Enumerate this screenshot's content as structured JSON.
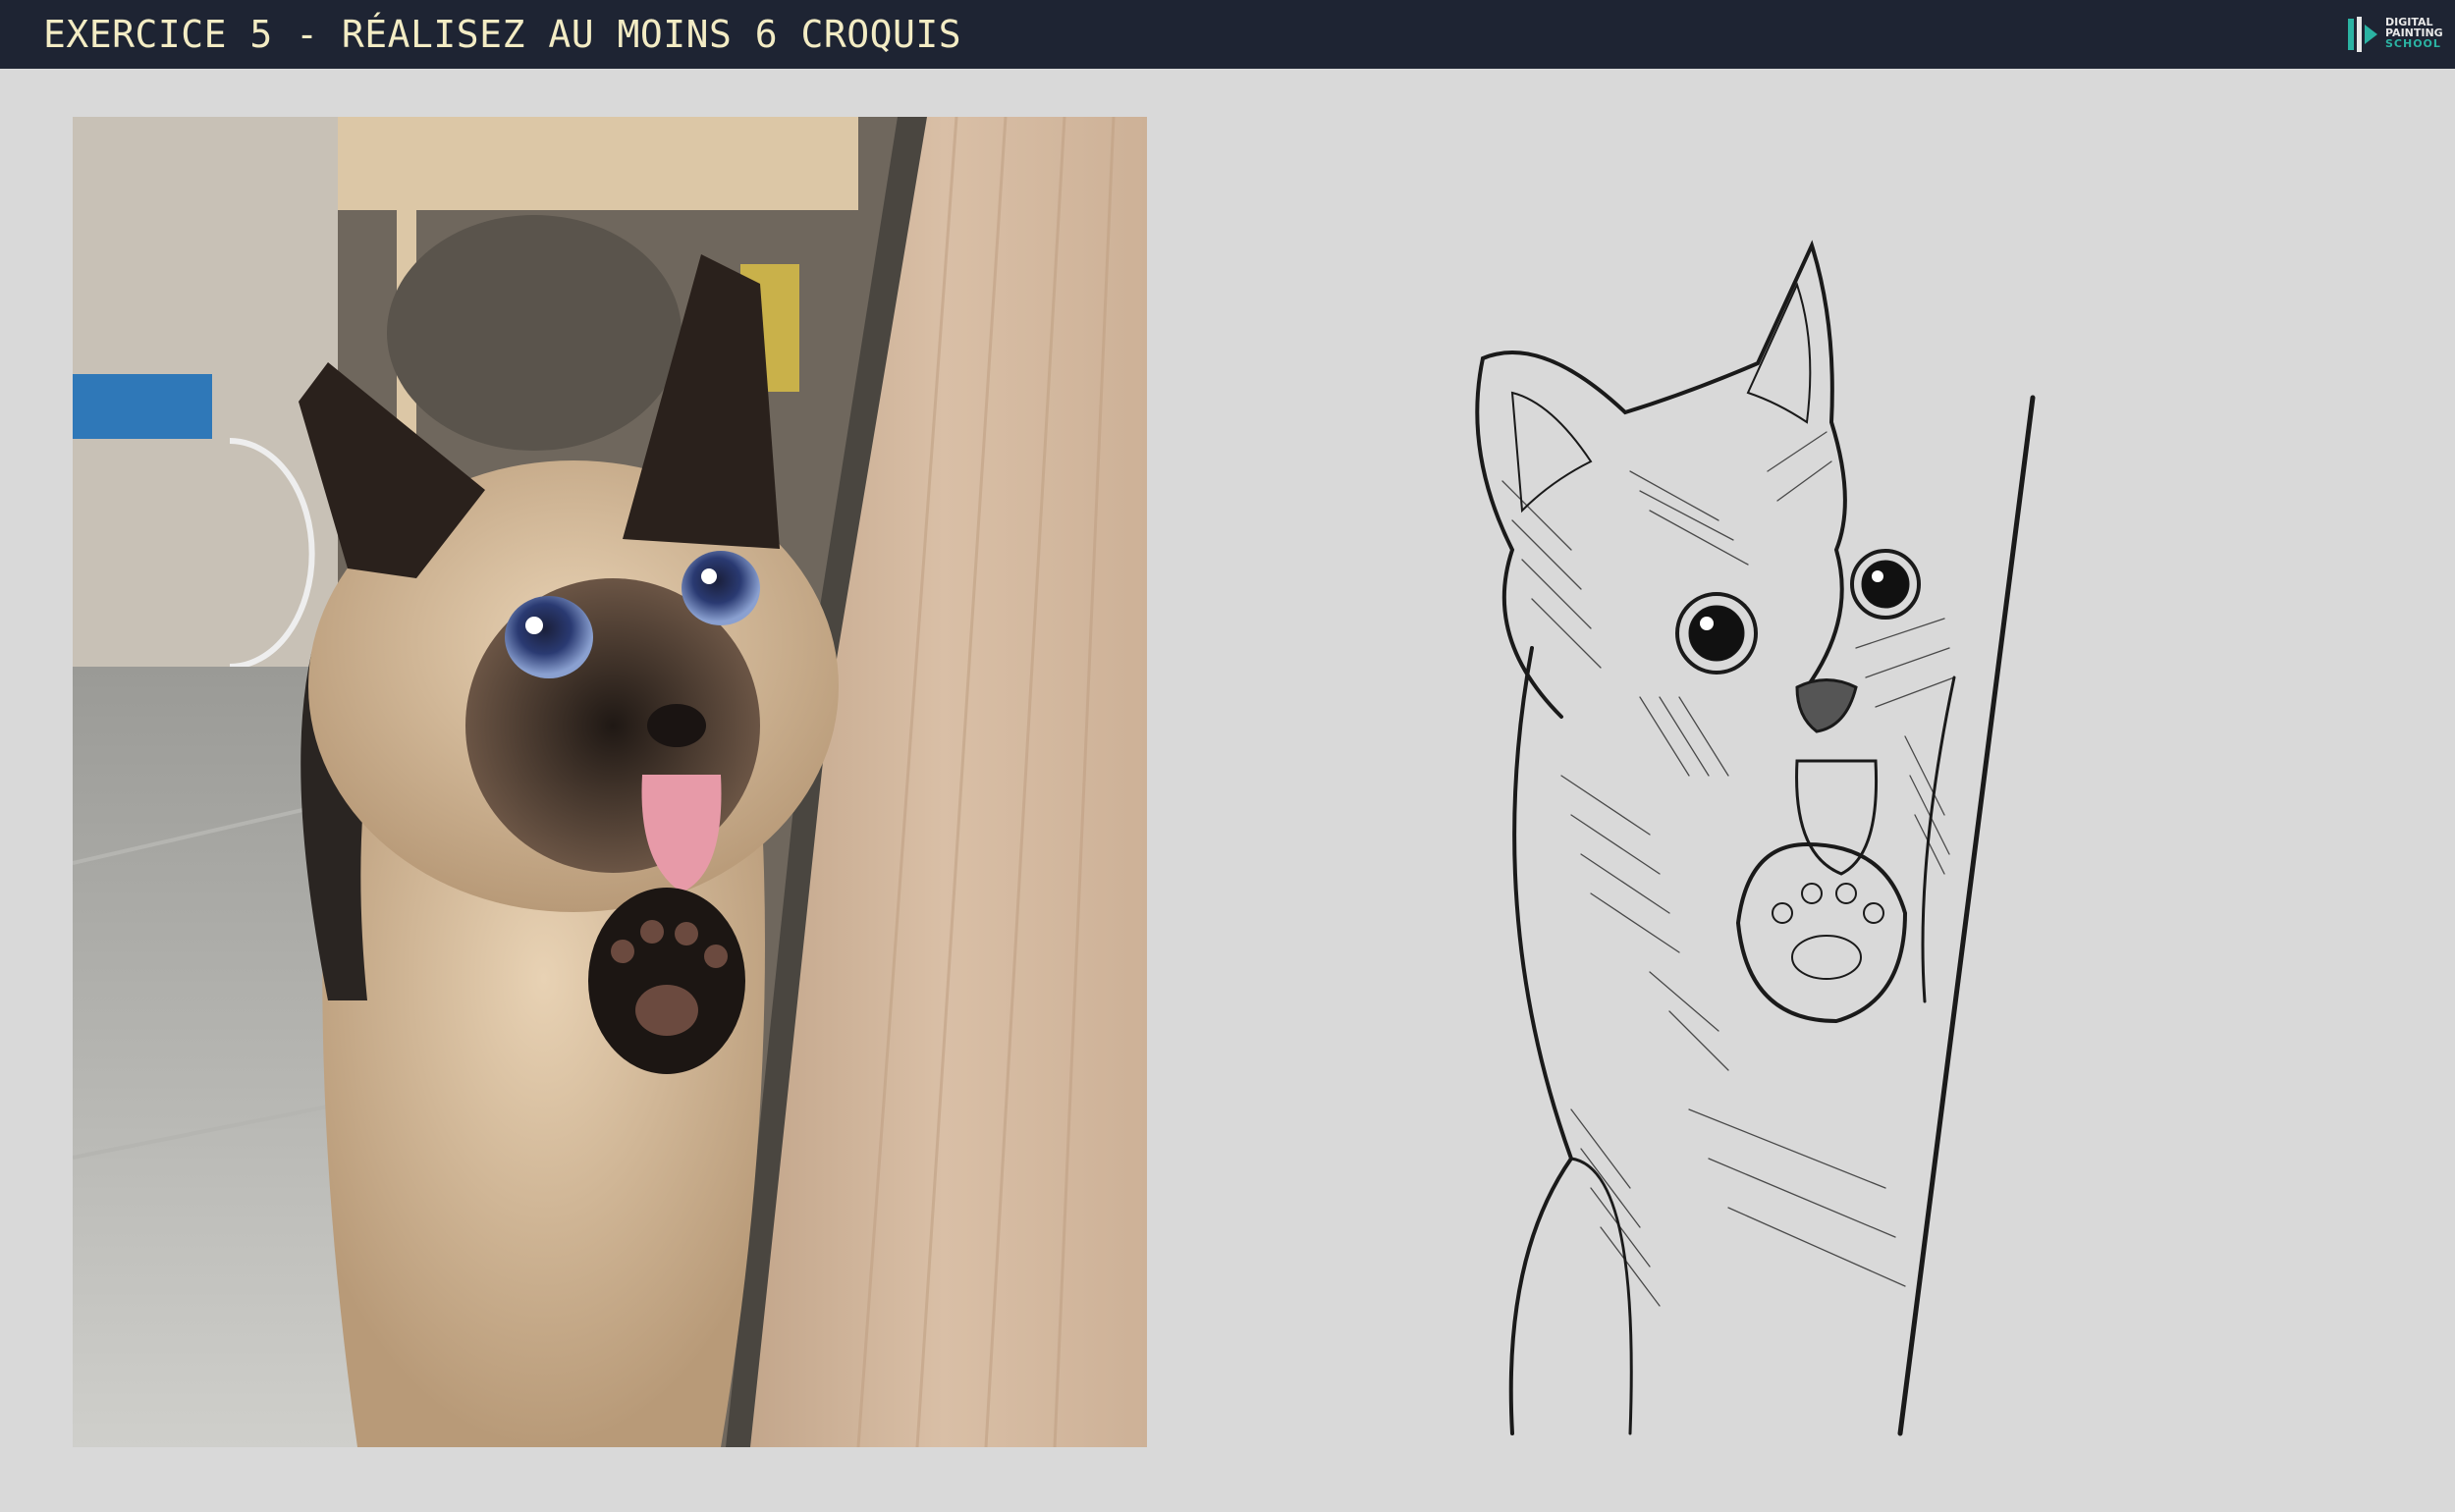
{
  "header": {
    "title": "EXERCICE 5 - RÉALISEZ AU MOINS 6 CROQUIS",
    "logo": {
      "line1": "DIGITAL",
      "line2": "PAINTING",
      "line3": "SCHOOL",
      "icon": "brush-logo-icon"
    }
  },
  "colors": {
    "header_bg": "#1e2433",
    "title_color": "#f3ecc4",
    "page_bg": "#d9d9d9",
    "accent": "#2bb3a3"
  },
  "panels": {
    "photo": {
      "subject": "siamese-cat-photo",
      "icon": "cat-photo-image"
    },
    "sketch": {
      "subject": "cat-line-sketch",
      "icon": "cat-sketch-image"
    }
  }
}
